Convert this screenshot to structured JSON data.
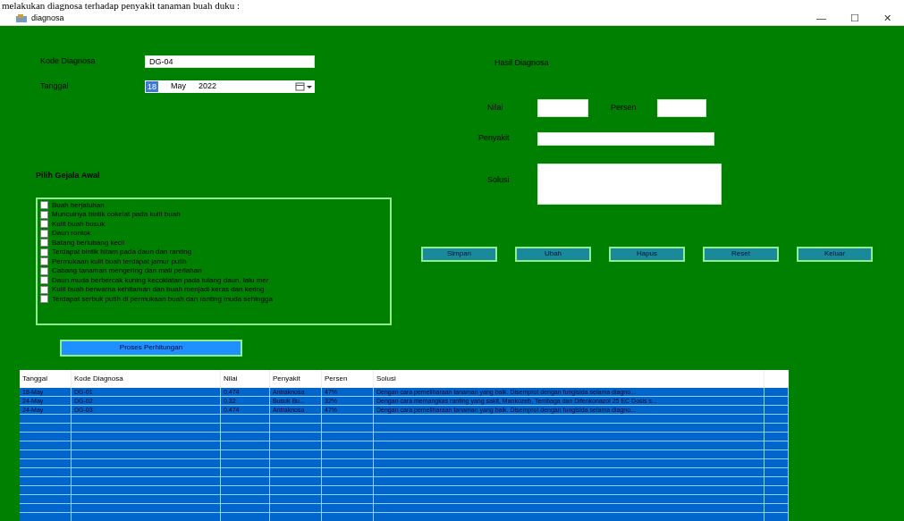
{
  "caption": "melakukan diagnosa terhadap penyakit tanaman buah duku :",
  "window": {
    "title": "diagnosa",
    "controls": [
      "—",
      "☐",
      "✕"
    ]
  },
  "kode_diagnosa": {
    "label": "Kode Diagnosa",
    "value": "DG-04"
  },
  "tanggal": {
    "label": "Tanggal",
    "day": "18",
    "month": "May",
    "year": "2022"
  },
  "hasil": {
    "title": "Hasil Diagnosa",
    "nilai": "Nilai",
    "persen": "Persen",
    "penyakit": "Penyakit",
    "solusi": "Solusi"
  },
  "gejala": {
    "title": "Pilih Gejala Awal",
    "items": [
      {
        "label": "Buah berjatuhan",
        "checked": false
      },
      {
        "label": "Munculnya bintik cokelat pada kulit buah",
        "checked": false
      },
      {
        "label": "Kulit buah busuk",
        "checked": false
      },
      {
        "label": "Daun rontok",
        "checked": false
      },
      {
        "label": "Batang berlubang kecil",
        "checked": false
      },
      {
        "label": "Terdapat bintik hitam pada daun dan ranting",
        "checked": false
      },
      {
        "label": "Permukaan kulit buah terdapat jamur putih",
        "checked": false
      },
      {
        "label": "Cabang tanaman mengering dan mati perlahan",
        "checked": false
      },
      {
        "label": "Daun muda berbercak kuning kecoklatan pada tulang daun, lalu mer",
        "checked": false
      },
      {
        "label": "Kulit buah berwarna kehitaman dan buah menjadi keras dan kering",
        "checked": false
      },
      {
        "label": "Terdapat serbuk putih di permukaan buah dan ranting muda sehingga",
        "checked": false
      }
    ]
  },
  "actions": [
    "Simpan",
    "Ubah",
    "Hapus",
    "Reset",
    "Keluar"
  ],
  "process_button": "Proses Perhitungan",
  "table": {
    "columns": [
      "Tanggal",
      "Kode Diagnosa",
      "Nilai",
      "Penyakit",
      "Persen",
      "Solusi"
    ],
    "rows": [
      [
        "18-May",
        "DG-01",
        "0.474",
        "Antraknosa",
        "47%",
        "Dengan cara pemeliharaan tanaman yang baik. Disemprot dengan fungisida selama diagno..."
      ],
      [
        "24-May",
        "DG-02",
        "0.32",
        "Busuk Bu...",
        "32%",
        "Dengan cara memangkas ranting yang sakit, Mankozeb, Tembaga dan Difenkonazol 25 EC Dosis s..."
      ],
      [
        "24-May",
        "DG-03",
        "0.474",
        "Antraknosa",
        "47%",
        "Dengan cara pemeliharaan tanaman yang baik. Disemprot dengan fungisida selama diagno..."
      ]
    ]
  }
}
